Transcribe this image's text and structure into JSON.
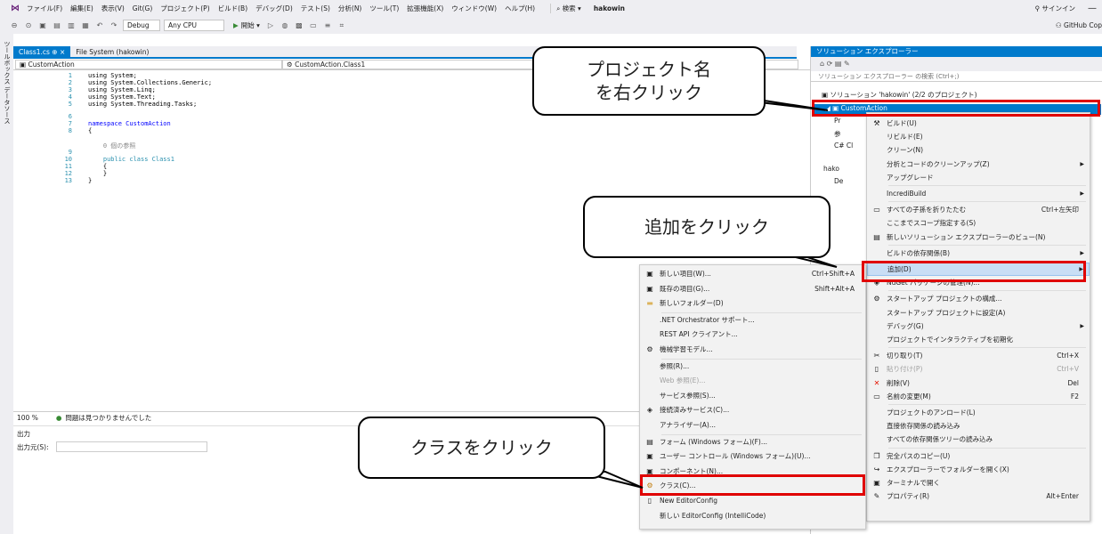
{
  "menubar": {
    "items": [
      "ファイル(F)",
      "編集(E)",
      "表示(V)",
      "Git(G)",
      "プロジェクト(P)",
      "ビルド(B)",
      "デバッグ(D)",
      "テスト(S)",
      "分析(N)",
      "ツール(T)",
      "拡張機能(X)",
      "ウィンドウ(W)",
      "ヘルプ(H)"
    ],
    "search": "検索",
    "project_name": "hakowin",
    "signin": "サインイン",
    "minimize": "—"
  },
  "toolbar": {
    "config": "Debug",
    "platform": "Any CPU",
    "start": "開始",
    "copilot": "GitHub Cop"
  },
  "left_strip": {
    "label": "ツールボックス データソース"
  },
  "editor": {
    "tabs": [
      {
        "label": "Class1.cs  ⊕  ×",
        "active": true
      },
      {
        "label": "File System (hakowin)",
        "active": false
      }
    ],
    "nav_left": "CustomAction",
    "nav_right": "CustomAction.Class1",
    "line_numbers": [
      "1",
      "2",
      "3",
      "4",
      "5",
      "6",
      "7",
      "8",
      "9",
      "10",
      "11",
      "12",
      "13"
    ],
    "code_lines": [
      "using System;",
      "using System.Collections.Generic;",
      "using System.Linq;",
      "using System.Text;",
      "using System.Threading.Tasks;",
      "",
      "namespace CustomAction",
      "{",
      "    0 個の参照",
      "    public class Class1",
      "    {",
      "    }",
      "}"
    ],
    "zoom": "100 %",
    "issues": "問題は見つかりませんでした"
  },
  "output": {
    "title": "出力",
    "source_label": "出力元(S):"
  },
  "solution_explorer": {
    "title": "ソリューション エクスプローラー",
    "search_placeholder": "ソリューション エクスプローラー の検索 (Ctrl+;)",
    "solution_node": "ソリューション 'hakowin' (2/2 のプロジェクト)",
    "project_node": "CustomAction",
    "partial_nodes": [
      "Pr",
      "参",
      "C# Cl",
      "hako",
      "De"
    ]
  },
  "context_menu_main": {
    "items": [
      {
        "label": "ビルド(U)",
        "shortcut": "",
        "arrow": false,
        "icon": "build-icon"
      },
      {
        "label": "リビルド(E)",
        "shortcut": "",
        "arrow": false,
        "icon": ""
      },
      {
        "label": "クリーン(N)",
        "shortcut": "",
        "arrow": false,
        "icon": ""
      },
      {
        "label": "分析とコードのクリーンアップ(Z)",
        "shortcut": "",
        "arrow": true,
        "icon": ""
      },
      {
        "label": "アップグレード",
        "shortcut": "",
        "arrow": false,
        "icon": ""
      },
      {
        "label": "IncrediBuild",
        "shortcut": "",
        "arrow": true,
        "icon": ""
      },
      {
        "label": "すべての子孫を折りたたむ",
        "shortcut": "Ctrl+左矢印",
        "arrow": false,
        "icon": "collapse-icon"
      },
      {
        "label": "ここまでスコープ指定する(S)",
        "shortcut": "",
        "arrow": false,
        "icon": ""
      },
      {
        "label": "新しいソリューション エクスプローラーのビュー(N)",
        "shortcut": "",
        "arrow": false,
        "icon": "new-view-icon"
      },
      {
        "label": "ビルドの依存関係(B)",
        "shortcut": "",
        "arrow": true,
        "icon": ""
      },
      {
        "label": "追加(D)",
        "shortcut": "",
        "arrow": true,
        "icon": ""
      },
      {
        "label": "NuGet パッケージの管理(N)...",
        "shortcut": "",
        "arrow": false,
        "icon": "nuget-icon"
      },
      {
        "label": "スタートアップ プロジェクトの構成...",
        "shortcut": "",
        "arrow": false,
        "icon": "gear-icon"
      },
      {
        "label": "スタートアップ プロジェクトに設定(A)",
        "shortcut": "",
        "arrow": false,
        "icon": ""
      },
      {
        "label": "デバッグ(G)",
        "shortcut": "",
        "arrow": true,
        "icon": ""
      },
      {
        "label": "プロジェクトでインタラクティブを初期化",
        "shortcut": "",
        "arrow": false,
        "icon": ""
      },
      {
        "label": "切り取り(T)",
        "shortcut": "Ctrl+X",
        "arrow": false,
        "icon": "scissors-icon"
      },
      {
        "label": "貼り付け(P)",
        "shortcut": "Ctrl+V",
        "arrow": false,
        "icon": "paste-icon"
      },
      {
        "label": "削除(V)",
        "shortcut": "Del",
        "arrow": false,
        "icon": "delete-icon"
      },
      {
        "label": "名前の変更(M)",
        "shortcut": "F2",
        "arrow": false,
        "icon": "rename-icon"
      },
      {
        "label": "プロジェクトのアンロード(L)",
        "shortcut": "",
        "arrow": false,
        "icon": ""
      },
      {
        "label": "直接依存関係の読み込み",
        "shortcut": "",
        "arrow": false,
        "icon": ""
      },
      {
        "label": "すべての依存関係ツリーの読み込み",
        "shortcut": "",
        "arrow": false,
        "icon": ""
      },
      {
        "label": "完全パスのコピー(U)",
        "shortcut": "",
        "arrow": false,
        "icon": "copy-icon"
      },
      {
        "label": "エクスプローラーでフォルダーを開く(X)",
        "shortcut": "",
        "arrow": false,
        "icon": "folder-open-icon"
      },
      {
        "label": "ターミナルで開く",
        "shortcut": "",
        "arrow": false,
        "icon": "terminal-icon"
      },
      {
        "label": "プロパティ(R)",
        "shortcut": "Alt+Enter",
        "arrow": false,
        "icon": "wrench-icon"
      }
    ]
  },
  "context_menu_add": {
    "items": [
      {
        "label": "新しい項目(W)...",
        "shortcut": "Ctrl+Shift+A",
        "icon": "new-item-icon"
      },
      {
        "label": "既存の項目(G)...",
        "shortcut": "Shift+Alt+A",
        "icon": "existing-item-icon"
      },
      {
        "label": "新しいフォルダー(D)",
        "shortcut": "",
        "icon": "folder-icon"
      },
      {
        "label": ".NET Orchestrator サポート...",
        "shortcut": "",
        "icon": ""
      },
      {
        "label": "REST API クライアント...",
        "shortcut": "",
        "icon": ""
      },
      {
        "label": "機械学習モデル...",
        "shortcut": "",
        "icon": "ml-icon"
      },
      {
        "label": "参照(R)...",
        "shortcut": "",
        "icon": ""
      },
      {
        "label": "Web 参照(E)...",
        "shortcut": "",
        "icon": ""
      },
      {
        "label": "サービス参照(S)...",
        "shortcut": "",
        "icon": ""
      },
      {
        "label": "接続済みサービス(C)...",
        "shortcut": "",
        "icon": "connected-service-icon"
      },
      {
        "label": "アナライザー(A)...",
        "shortcut": "",
        "icon": ""
      },
      {
        "label": "フォーム (Windows フォーム)(F)...",
        "shortcut": "",
        "icon": "form-icon"
      },
      {
        "label": "ユーザー コントロール (Windows フォーム)(U)...",
        "shortcut": "",
        "icon": "user-control-icon"
      },
      {
        "label": "コンポーネント(N)...",
        "shortcut": "",
        "icon": "component-icon"
      },
      {
        "label": "クラス(C)...",
        "shortcut": "",
        "icon": "class-icon"
      },
      {
        "label": "New EditorConfig",
        "shortcut": "",
        "icon": "editorconfig-icon"
      },
      {
        "label": "新しい EditorConfig (IntelliCode)",
        "shortcut": "",
        "icon": ""
      }
    ]
  },
  "callouts": {
    "project": "プロジェクト名\nを右クリック",
    "add": "追加をクリック",
    "class": "クラスをクリック"
  }
}
